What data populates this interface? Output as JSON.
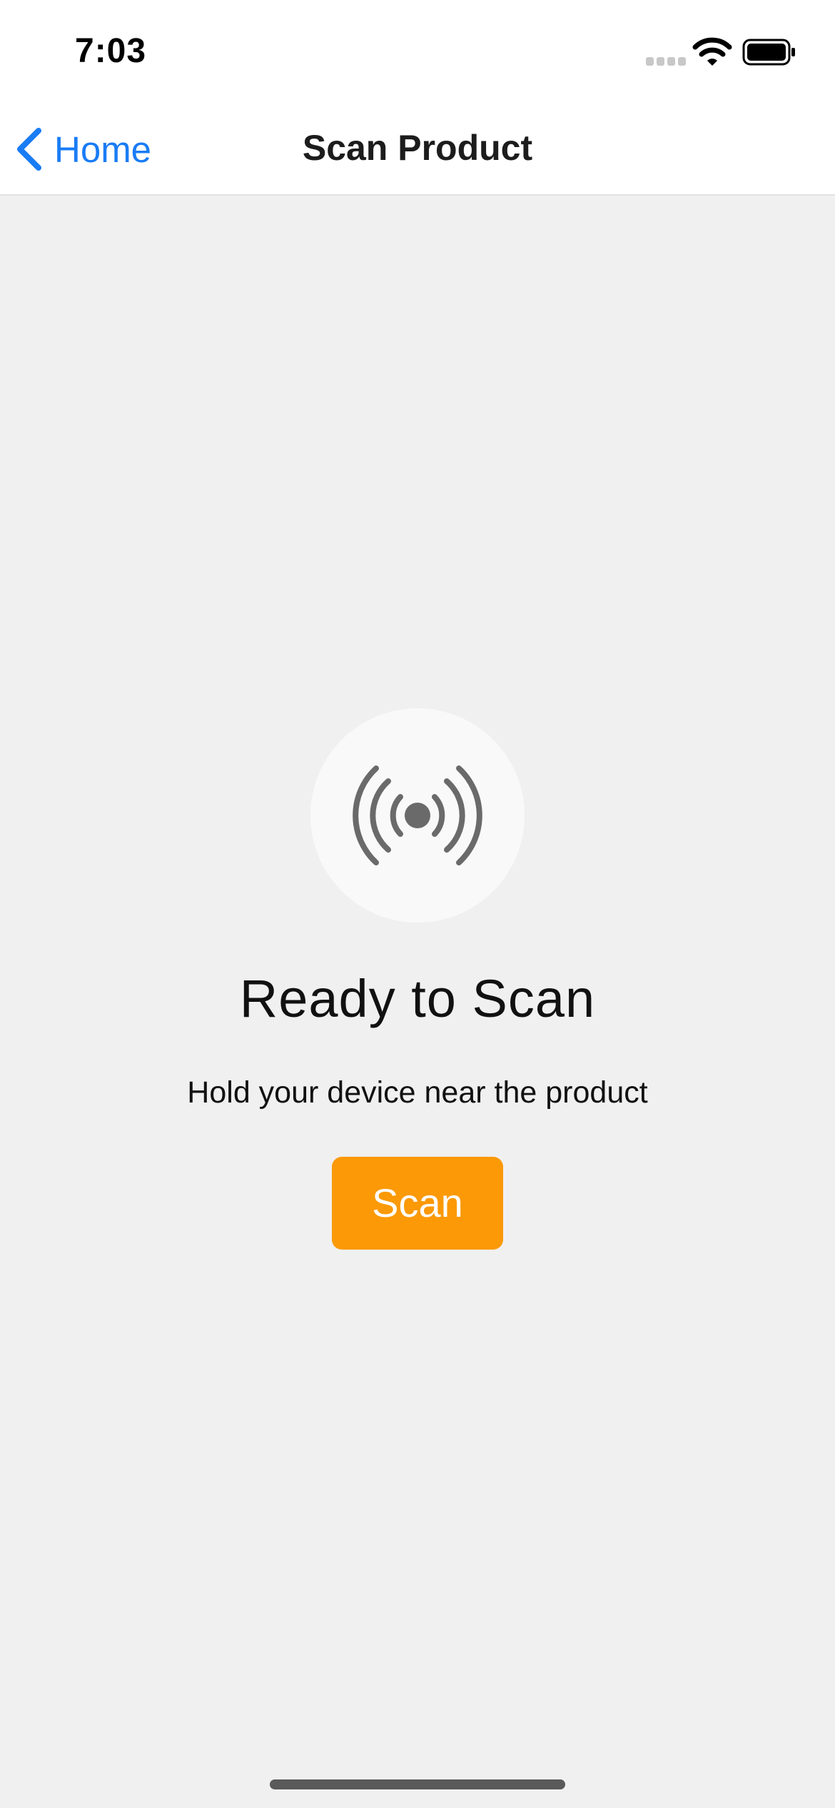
{
  "status_bar": {
    "time": "7:03",
    "icons": [
      "signal-dots-icon",
      "wifi-icon",
      "battery-icon"
    ]
  },
  "nav": {
    "back_label": "Home",
    "back_icon": "chevron-left-icon",
    "title": "Scan Product"
  },
  "main": {
    "icon": "nfc-waves-icon",
    "headline": "Ready to Scan",
    "subtitle": "Hold your device near the product",
    "scan_button_label": "Scan"
  },
  "colors": {
    "accent_blue": "#1a7cf5",
    "scan_button": "#fb9906",
    "background": "#f0f0f0",
    "icon_gray": "#6a6a6a"
  }
}
